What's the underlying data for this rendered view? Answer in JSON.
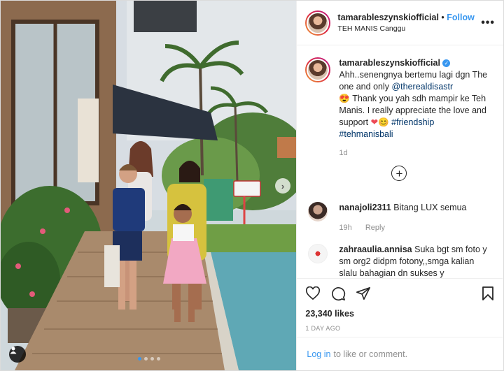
{
  "header": {
    "username": "tamarableszynskiofficial",
    "separator": "•",
    "follow_label": "Follow",
    "location": "TEH MANIS Canggu",
    "more_label": "•••"
  },
  "caption": {
    "username": "tamarableszynskiofficial",
    "verified_mark": "✓",
    "text_1": "Ahh..senengnya bertemu lagi dgn The one and only ",
    "mention": "@therealdisastr",
    "emoji_1": "😍",
    "text_2": " Thank you yah sdh mampir ke Teh Manis. I really appreciate the love and support ",
    "emoji_heart": "❤",
    "emoji_smile": "😊",
    "hashtag_1": "#friendship",
    "hashtag_2": "#tehmanisbali",
    "time": "1d"
  },
  "load_more_icon": "plus-circle-icon",
  "load_more_label": "+",
  "comments": [
    {
      "username": "nanajoli2311",
      "text": "Bitang LUX semua",
      "time": "19h",
      "reply_label": "Reply"
    },
    {
      "username": "zahraaulia.annisa",
      "text": "Suka bgt sm foto y sm org2 didpm fotony,,smga kalian slalu bahagian dn sukses y",
      "time": "",
      "reply_label": ""
    }
  ],
  "actions": {
    "like_icon": "heart-icon",
    "comment_icon": "comment-icon",
    "share_icon": "share-icon",
    "save_icon": "bookmark-icon"
  },
  "likes": "23,340 likes",
  "posted_ago": "1 DAY AGO",
  "login_bar": {
    "login_label": "Log in",
    "suffix": "to like or comment."
  },
  "carousel": {
    "next_label": "›",
    "slides": 4,
    "active_slide": 1
  },
  "colors": {
    "accent": "#3897f0",
    "text": "#262626",
    "muted": "#8e8e8e",
    "border": "#efefef"
  }
}
